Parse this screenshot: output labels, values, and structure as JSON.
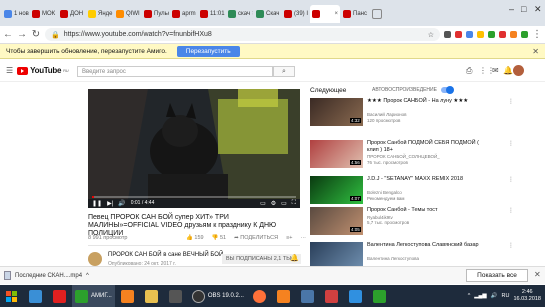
{
  "browser": {
    "tabs": [
      {
        "label": "1 нов",
        "color": "#4a86e8"
      },
      {
        "label": "МОК",
        "color": "#cc0000"
      },
      {
        "label": "ДОН",
        "color": "#cc0000"
      },
      {
        "label": "Янде",
        "color": "#ffcc00"
      },
      {
        "label": "QIWI",
        "color": "#ff8c00"
      },
      {
        "label": "Пульс",
        "color": "#cc0000"
      },
      {
        "label": "aprm",
        "color": "#cc0000"
      },
      {
        "label": "11:01",
        "color": "#cc0000"
      },
      {
        "label": "скач",
        "color": "#2e8b57"
      },
      {
        "label": "Скач",
        "color": "#2e8b57"
      },
      {
        "label": "(39) I",
        "color": "#cc0000"
      },
      {
        "label": "",
        "color": "#cc0000",
        "active": true
      },
      {
        "label": "Панс",
        "color": "#cc0000"
      }
    ],
    "url": "https://www.youtube.com/watch?v=fnunbifHXu8",
    "notification": "Чтобы завершить обновление, перезапустите Амиго.",
    "restart_label": "Перезапустить"
  },
  "youtube": {
    "logo_text": "YouTube",
    "logo_region": "RU",
    "search_placeholder": "Введите запрос",
    "up_next_label": "Следующее",
    "autoplay_label": "АВТОВОСПРОИЗВЕДЕНИЕ",
    "video": {
      "time_label": "0:01 / 4:44",
      "progress": 0.01,
      "title": "Певец ПРОРОК САН БОЙ супер ХИТ» ТРИ МАЛИНЫ»=OFFICIAL VIDEO друзьям к празднику К ДНЮ ПОЛИЦИИ",
      "views": "8 991 просмотр",
      "likes": "159",
      "dislikes": "51",
      "share_label": "ПОДЕЛИТЬСЯ",
      "channel": "ПРОРОК САН БОЙ в сане ВЕЧНЫЙ БОЙ",
      "published": "Опубликовано: 24 окт. 2017 г.",
      "subscribe_label": "ВЫ ПОДПИСАНЫ  2,1 ТЫС."
    },
    "recommendations": [
      {
        "title": "★★★ Пророк САНБОЙ - На лунy ★★★",
        "meta": [
          "Василий Ларионов",
          "120 просмотров"
        ],
        "duration": "4:32",
        "color1": "#3a2a24",
        "color2": "#8a6a50"
      },
      {
        "title": "Пророк Санбой ПОДМОЙ СЕБЯ ПОДМОЙ ( клип ) 18+",
        "meta": [
          "ПРОРОК САНБОЙ_СОЛНЦЕВОЙ_",
          "76 тыс. просмотров"
        ],
        "duration": "4:56",
        "color1": "#b04040",
        "color2": "#e0c0b0"
      },
      {
        "title": "J.D.J - \"SETANAY\" MAXX REMIX 2018",
        "meta": [
          "Bolezni Bengalco",
          "Рекомендуем вам"
        ],
        "duration": "4:07",
        "color1": "#0a3a10",
        "color2": "#30c040"
      },
      {
        "title": "Пророк Санбой - Темы тост",
        "meta": [
          "Ryabul4ik9tv",
          "5,7 тыс. просмотров"
        ],
        "duration": "4:05",
        "color1": "#5a4a40",
        "color2": "#c09070"
      },
      {
        "title": "Валентина Легкоступова Славянский базар",
        "meta": [
          "Валентина Легкоступова"
        ],
        "duration": "",
        "color1": "#2a3f5a",
        "color2": "#7090b0"
      }
    ]
  },
  "downloads": {
    "file_label": "Последние СКАН....mp4",
    "show_all_label": "Показать все"
  },
  "taskbar": {
    "amigo_label": "АМИГ...",
    "obs_label": "OBS 19.0.2...",
    "icons": [
      {
        "name": "ie-icon",
        "color": "#3a8fd6"
      },
      {
        "name": "yandex-icon",
        "color": "#e02020"
      },
      {
        "name": "ok-icon",
        "color": "#f58220"
      },
      {
        "name": "folder-icon",
        "color": "#e8c050"
      },
      {
        "name": "winamp-icon",
        "color": "#555"
      },
      {
        "name": "firefox-icon",
        "color": "#ff7139"
      },
      {
        "name": "ok2-icon",
        "color": "#f58220"
      },
      {
        "name": "vk-icon",
        "color": "#4a76a8"
      },
      {
        "name": "media-icon",
        "color": "#d04040"
      },
      {
        "name": "app-icon",
        "color": "#3090e0"
      },
      {
        "name": "amigo2-icon",
        "color": "#2ca02c"
      }
    ],
    "lang": "RU",
    "time": "2:46",
    "date": "16.03.2018"
  }
}
